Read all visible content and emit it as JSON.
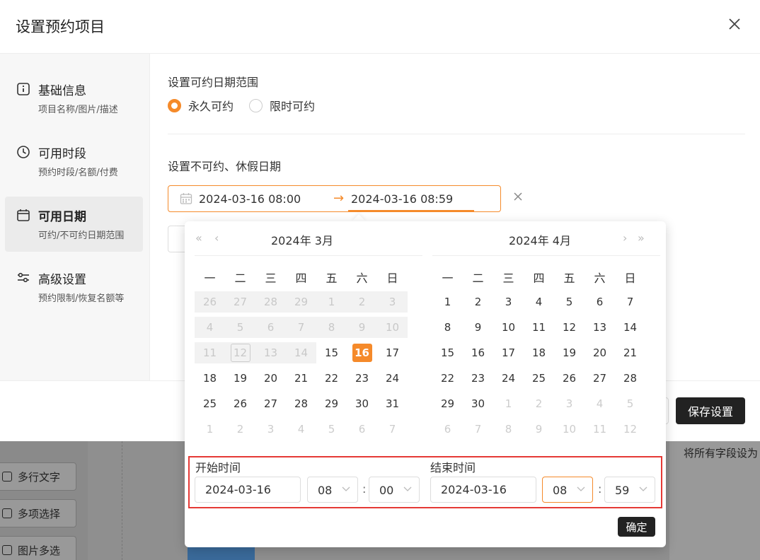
{
  "modal": {
    "title": "设置预约项目"
  },
  "sidebar": {
    "items": [
      {
        "label": "基础信息",
        "sub": "项目名称/图片/描述",
        "icon": "info-icon"
      },
      {
        "label": "可用时段",
        "sub": "预约时段/名额/付费",
        "icon": "clock-icon"
      },
      {
        "label": "可用日期",
        "sub": "可约/不可约日期范围",
        "icon": "calendar-icon"
      },
      {
        "label": "高级设置",
        "sub": "预约限制/恢复名额等",
        "icon": "sliders-icon"
      }
    ]
  },
  "content": {
    "range_label": "设置可约日期范围",
    "radio_forever": "永久可约",
    "radio_limited": "限时可约",
    "holiday_label": "设置不可约、休假日期",
    "range_start": "2024-03-16 08:00",
    "range_arrow": "→",
    "range_end": "2024-03-16 08:59"
  },
  "calendar": {
    "left_title": "2024年  3月",
    "right_title": "2024年  4月",
    "nav_prev_year": "«",
    "nav_prev_month": "‹",
    "nav_next_month": "›",
    "nav_next_year": "»",
    "weekdays": [
      "一",
      "二",
      "三",
      "四",
      "五",
      "六",
      "日"
    ],
    "left_days": [
      "26",
      "27",
      "28",
      "29",
      "1",
      "2",
      "3",
      "4",
      "5",
      "6",
      "7",
      "8",
      "9",
      "10",
      "11",
      "12",
      "13",
      "14",
      "15",
      "16",
      "17",
      "18",
      "19",
      "20",
      "21",
      "22",
      "23",
      "24",
      "25",
      "26",
      "27",
      "28",
      "29",
      "30",
      "31",
      "1",
      "2",
      "3",
      "4",
      "5",
      "6",
      "7"
    ],
    "right_days": [
      "1",
      "2",
      "3",
      "4",
      "5",
      "6",
      "7",
      "8",
      "9",
      "10",
      "11",
      "12",
      "13",
      "14",
      "15",
      "16",
      "17",
      "18",
      "19",
      "20",
      "21",
      "22",
      "23",
      "24",
      "25",
      "26",
      "27",
      "28",
      "29",
      "30",
      "1",
      "2",
      "3",
      "4",
      "5",
      "6",
      "7",
      "8",
      "9",
      "10",
      "11",
      "12"
    ]
  },
  "time": {
    "start_label": "开始时间",
    "start_date": "2024-03-16",
    "start_hour": "08",
    "start_minute": "00",
    "end_label": "结束时间",
    "end_date": "2024-03-16",
    "end_hour": "08",
    "end_minute": "59",
    "colon": ":",
    "confirm": "确定"
  },
  "footer": {
    "save": "保存设置"
  },
  "background": {
    "items": [
      "多行文字",
      "多项选择",
      "图片多选"
    ],
    "right_text": "将所有字段设为"
  },
  "colors": {
    "accent": "#f58a2a",
    "highlight_box": "#e53935",
    "dark_button": "#222222"
  }
}
